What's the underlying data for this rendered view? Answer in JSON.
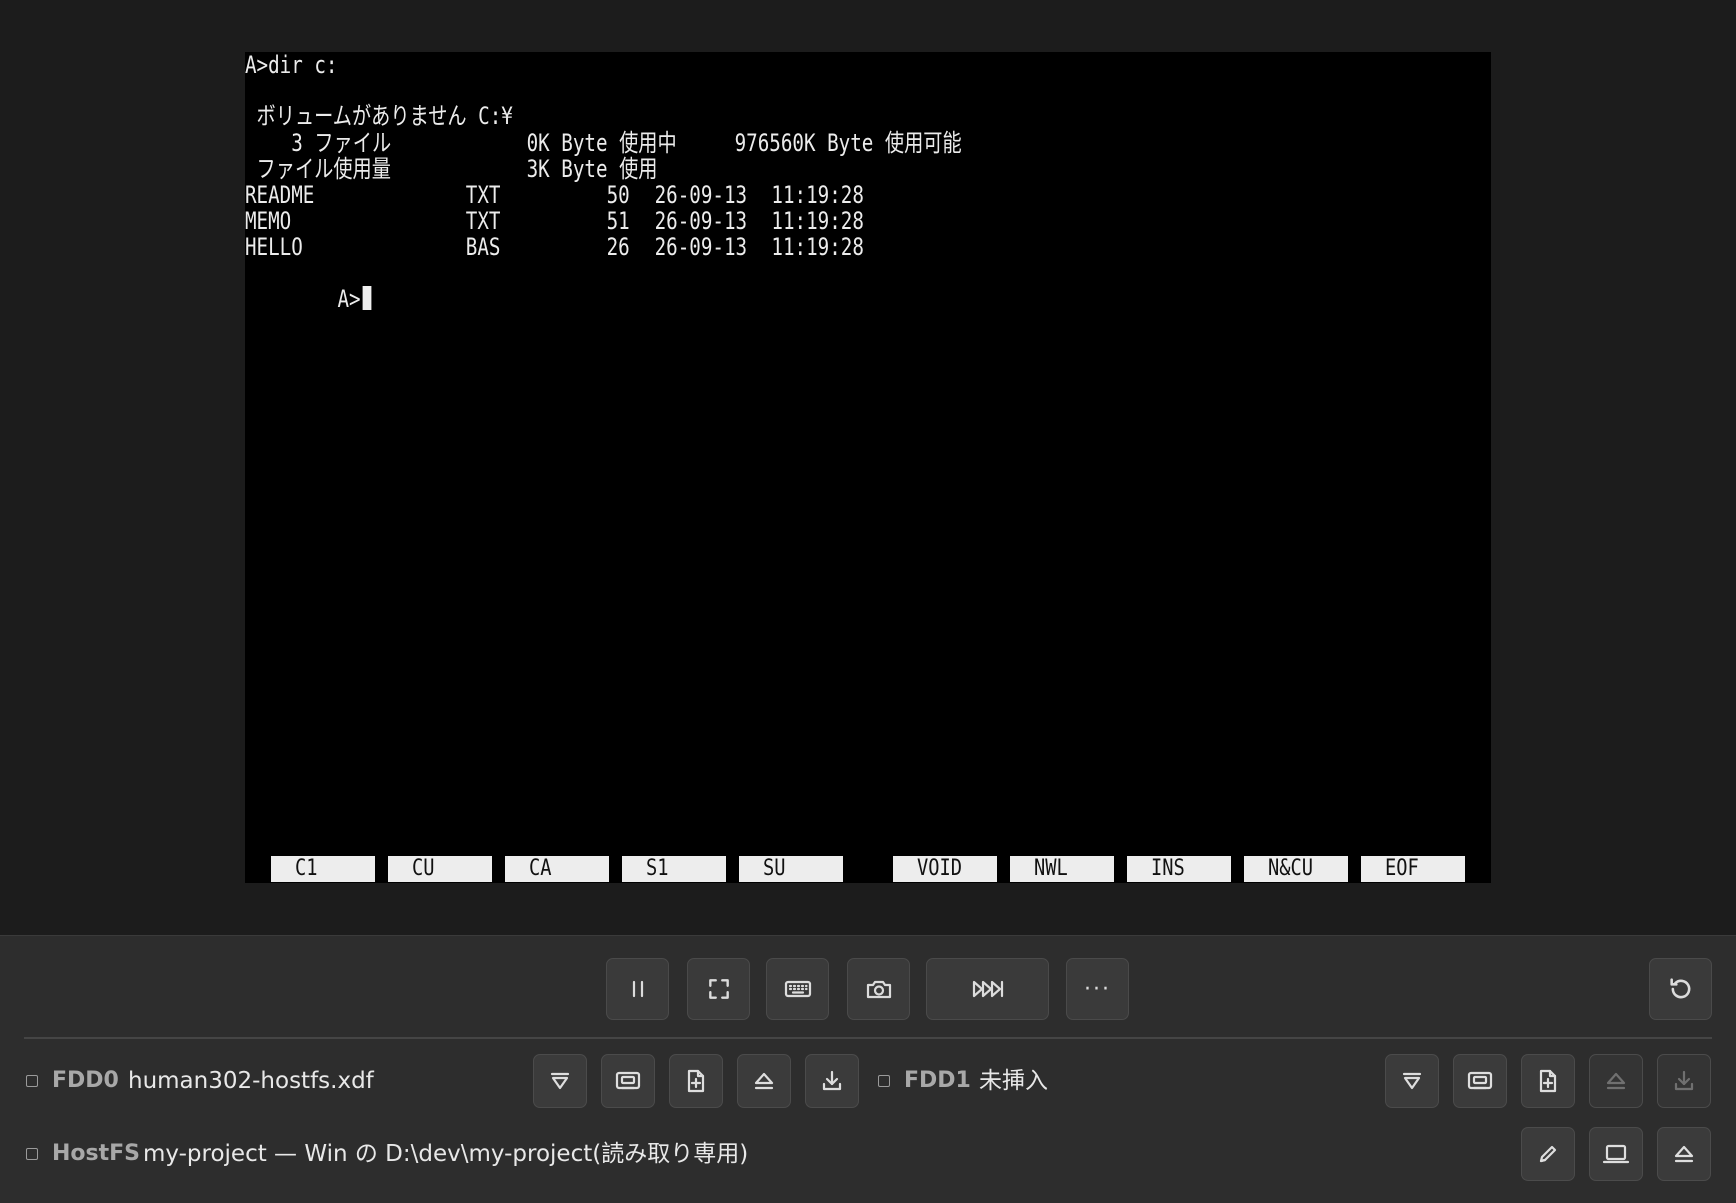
{
  "terminal": {
    "lines": [
      [
        "A>dir c:"
      ],
      [
        ""
      ],
      [
        " ボリュームがありません C:¥"
      ],
      [
        "    3 ファイル",
        "0K Byte 使用中",
        "976560K Byte 使用可能"
      ],
      [
        " ファイル使用量",
        "3K Byte 使用"
      ],
      [
        "README",
        "TXT",
        "50",
        "26-09-13",
        "11:19:28"
      ],
      [
        "MEMO",
        "TXT",
        "51",
        "26-09-13",
        "11:19:28"
      ],
      [
        "HELLO",
        "BAS",
        "26",
        "26-09-13",
        "11:19:28"
      ]
    ],
    "prompt": "A>"
  },
  "function_keys": [
    "C1",
    "CU",
    "CA",
    "S1",
    "SU",
    "VOID",
    "NWL",
    "INS",
    "N&CU",
    "EOF"
  ],
  "toolbar": {
    "pause_icon": "pause-icon",
    "fullscreen_icon": "fullscreen-icon",
    "keyboard_icon": "keyboard-icon",
    "screenshot_icon": "camera-icon",
    "fast_forward_icon": "fast-forward-icon",
    "more_label": "···",
    "reset_icon": "reset-icon"
  },
  "fdd0": {
    "label": "FDD0",
    "value": "human302-hostfs.xdf"
  },
  "fdd1": {
    "label": "FDD1",
    "value": "未挿入"
  },
  "hostfs": {
    "label": "HostFS",
    "value": "my-project — Win の D:\\dev\\my-project(読み取り専用)"
  },
  "colors": {
    "background": "#1c1c1c",
    "panel": "#2d2d2d",
    "screen": "#000000",
    "text": "#ececec"
  }
}
